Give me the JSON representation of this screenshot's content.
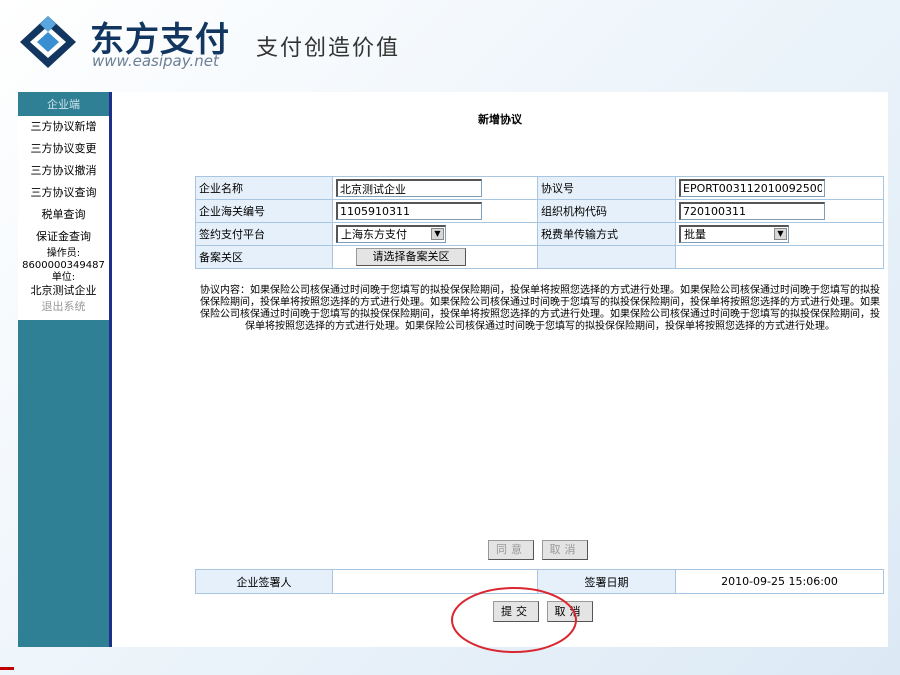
{
  "header": {
    "brand_name": "东方支付",
    "brand_url": "www.easipay.net",
    "slogan": "支付创造价值"
  },
  "sidebar": {
    "title": "企业端",
    "items": [
      {
        "label": "三方协议新增"
      },
      {
        "label": "三方协议变更"
      },
      {
        "label": "三方协议撤消"
      },
      {
        "label": "三方协议查询"
      },
      {
        "label": "税单查询"
      },
      {
        "label": "保证金查询"
      }
    ],
    "operator_label": "操作员:",
    "operator_value": "8600000349487",
    "unit_label": "单位:",
    "unit_value": "北京测试企业",
    "logout": "退出系统"
  },
  "page": {
    "title": "新增协议"
  },
  "form": {
    "company_name_label": "企业名称",
    "company_name_value": "北京测试企业",
    "agreement_no_label": "协议号",
    "agreement_no_value": "EPORT00311201009250000",
    "customs_code_label": "企业海关编号",
    "customs_code_value": "1105910311",
    "org_code_label": "组织机构代码",
    "org_code_value": "720100311",
    "platform_label": "签约支付平台",
    "platform_value": "上海东方支付",
    "transmit_label": "税费单传输方式",
    "transmit_value": "批量",
    "customs_area_label": "备案关区",
    "customs_area_button": "请选择备案关区"
  },
  "agreement_text": "协议内容：如果保险公司核保通过时间晚于您填写的拟投保保险期间，投保单将按照您选择的方式进行处理。如果保险公司核保通过时间晚于您填写的拟投保保险期间，投保单将按照您选择的方式进行处理。如果保险公司核保通过时间晚于您填写的拟投保保险期间，投保单将按照您选择的方式进行处理。如果保险公司核保通过时间晚于您填写的拟投保保险期间，投保单将按照您选择的方式进行处理。如果保险公司核保通过时间晚于您填写的拟投保保险期间，投保单将按照您选择的方式进行处理。如果保险公司核保通过时间晚于您填写的拟投保保险期间，投保单将按照您选择的方式进行处理。",
  "buttons": {
    "agree": "同意",
    "cancel_agree": "取消",
    "submit": "提交",
    "cancel": "取消"
  },
  "signature": {
    "signer_label": "企业签署人",
    "signer_value": "",
    "date_label": "签署日期",
    "date_value": "2010-09-25 15:06:00"
  },
  "colors": {
    "sidebar_bg": "#2f7f95",
    "sidebar_border": "#1d2f8a",
    "table_border": "#a8c6e0",
    "highlight": "#d9262f",
    "brand": "#12365f"
  },
  "icons": {
    "logo": "easipay-diamond-logo",
    "select_arrow": "chevron-down-icon"
  }
}
